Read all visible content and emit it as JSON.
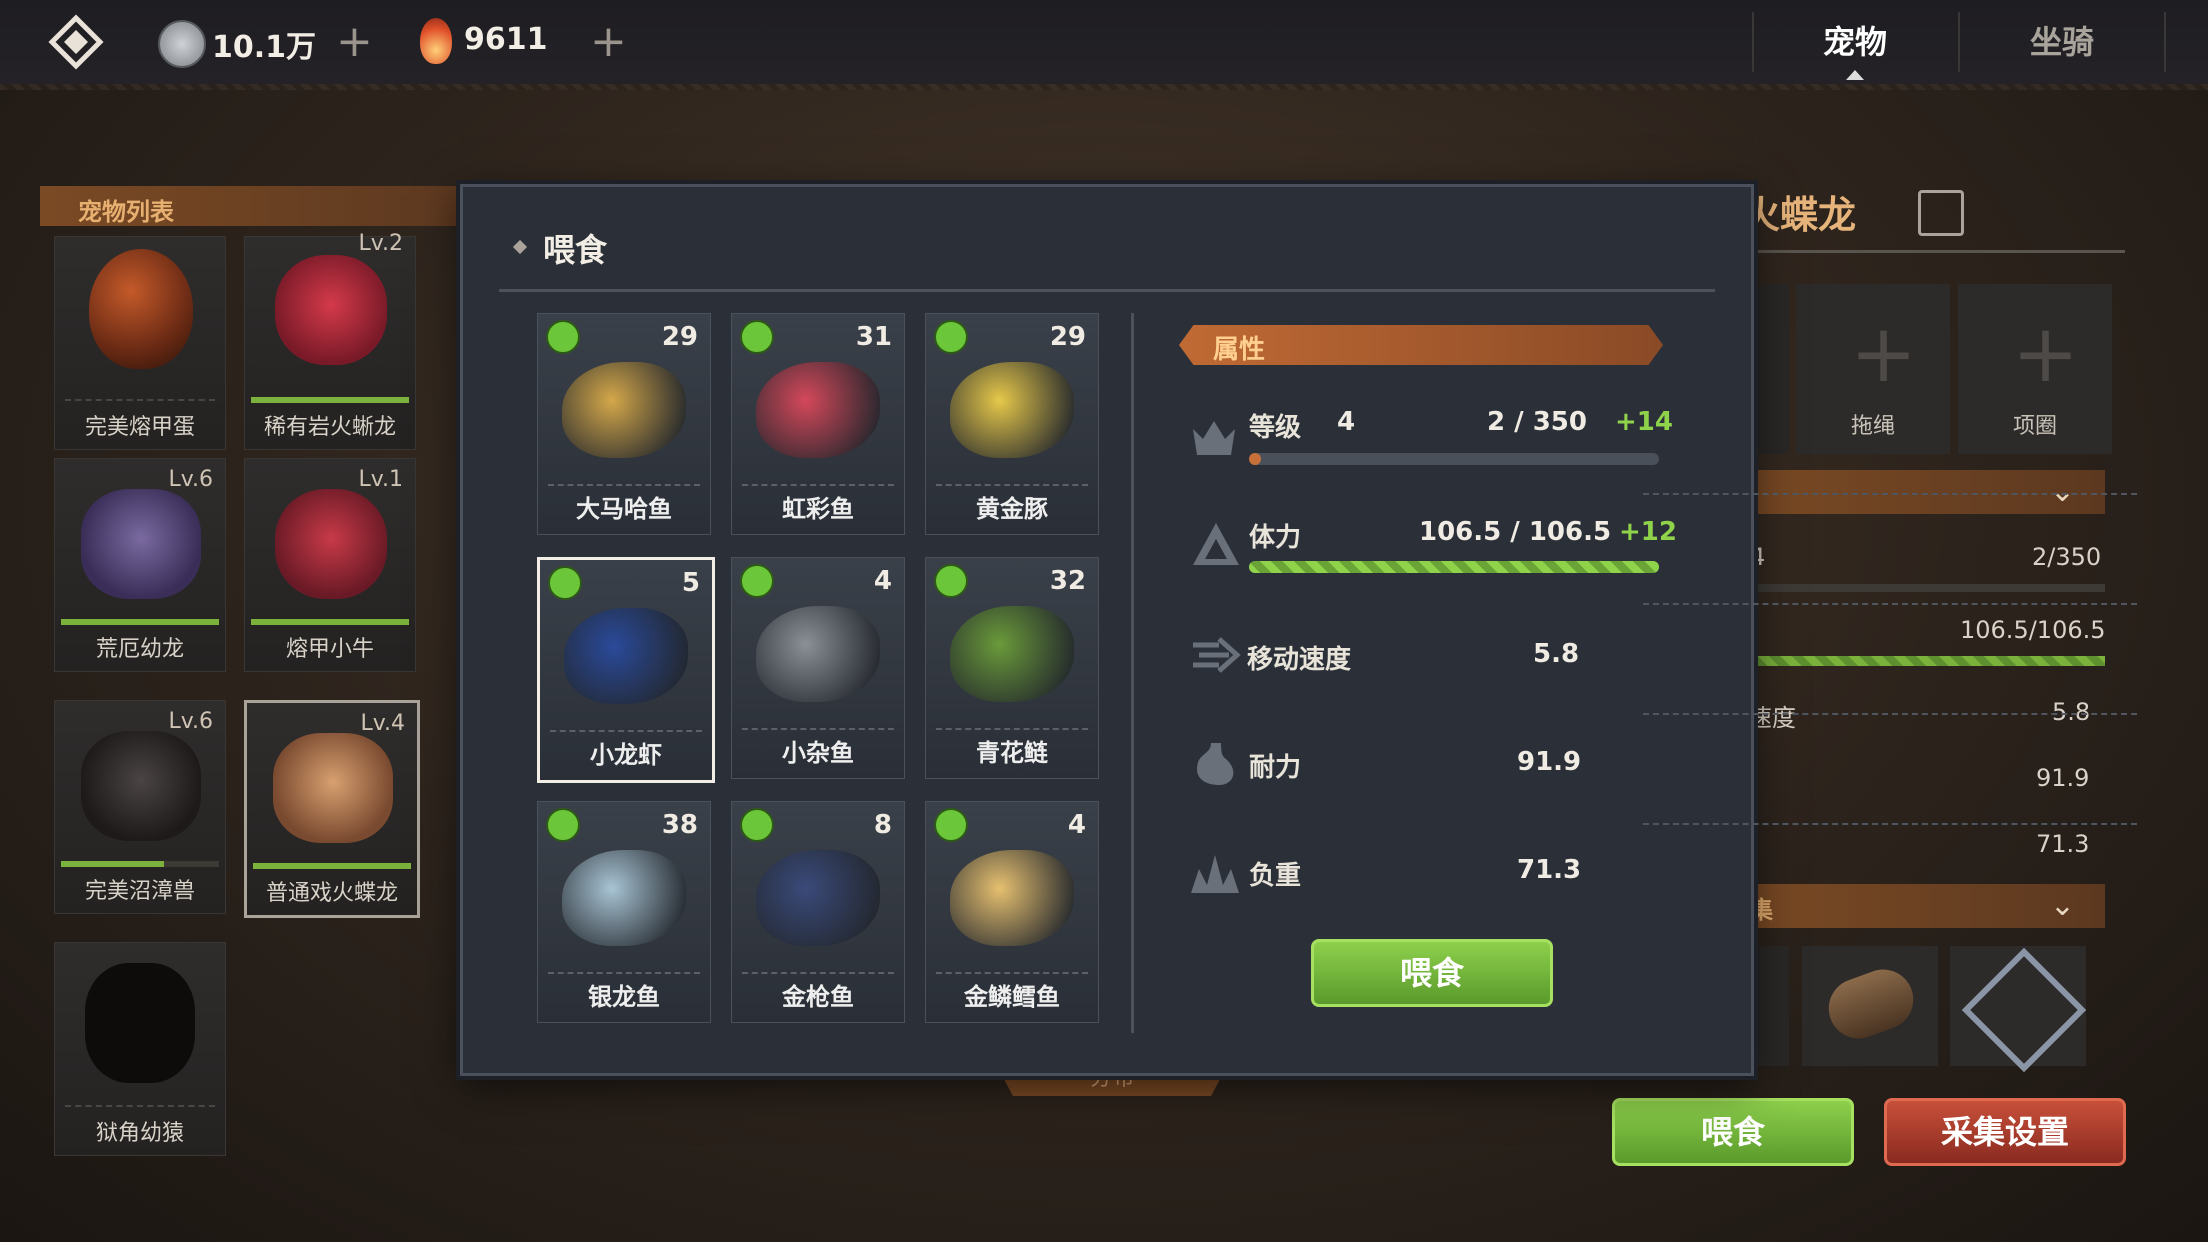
{
  "topbar": {
    "silver_amount": "10.1万",
    "gem_amount": "9611",
    "tabs": [
      "宠物",
      "坐骑"
    ]
  },
  "left_panel": {
    "title": "宠物列表",
    "pets": [
      {
        "name": "完美熔甲蛋",
        "level": "",
        "progress": 0
      },
      {
        "name": "稀有岩火蜥龙",
        "level": "Lv.2",
        "progress": 1.0
      },
      {
        "name": "荒厄幼龙",
        "level": "Lv.6",
        "progress": 1.0
      },
      {
        "name": "熔甲小牛",
        "level": "Lv.1",
        "progress": 1.0
      },
      {
        "name": "完美沼漳兽",
        "level": "Lv.6",
        "progress": 0.65
      },
      {
        "name": "普通戏火蝶龙",
        "level": "Lv.4",
        "progress": 1.0
      },
      {
        "name": "狱角幼猿",
        "level": "",
        "progress": 0
      }
    ]
  },
  "right_panel": {
    "pet_name_partial": "火蝶龙",
    "equip_slots": [
      "拖绳",
      "项圈"
    ],
    "level": "4",
    "level_exp": "2/350",
    "hp": "106.5/106.5",
    "speed_label_partial": "速度",
    "speed": "5.8",
    "endurance": "91.9",
    "load": "71.3",
    "gather_label_partial": "集",
    "feed_button": "喂食",
    "gather_settings_button": "采集设置",
    "under_modal_tab": "分布"
  },
  "modal": {
    "title": "喂食",
    "foods": [
      {
        "name": "大马哈鱼",
        "count": "29"
      },
      {
        "name": "虹彩鱼",
        "count": "31"
      },
      {
        "name": "黄金豚",
        "count": "29"
      },
      {
        "name": "小龙虾",
        "count": "5"
      },
      {
        "name": "小杂鱼",
        "count": "4"
      },
      {
        "name": "青花鲢",
        "count": "32"
      },
      {
        "name": "银龙鱼",
        "count": "38"
      },
      {
        "name": "金枪鱼",
        "count": "8"
      },
      {
        "name": "金鳞鳕鱼",
        "count": "4"
      }
    ],
    "selected_food": "小龙虾",
    "attributes_header": "属性",
    "stats": {
      "level_label": "等级",
      "level_value": "4",
      "level_exp": "2 / 350",
      "level_gain": "+14",
      "level_progress": 0.006,
      "hp_label": "体力",
      "hp_value": "106.5 / 106.5",
      "hp_gain": "+12",
      "hp_progress": 1.0,
      "speed_label": "移动速度",
      "speed_value": "5.8",
      "endurance_label": "耐力",
      "endurance_value": "91.9",
      "load_label": "负重",
      "load_value": "71.3"
    },
    "feed_button": "喂食"
  },
  "colors": {
    "accent_green": "#7bb23c",
    "accent_orange": "#b8622e",
    "gain_green": "#8fd34a"
  }
}
